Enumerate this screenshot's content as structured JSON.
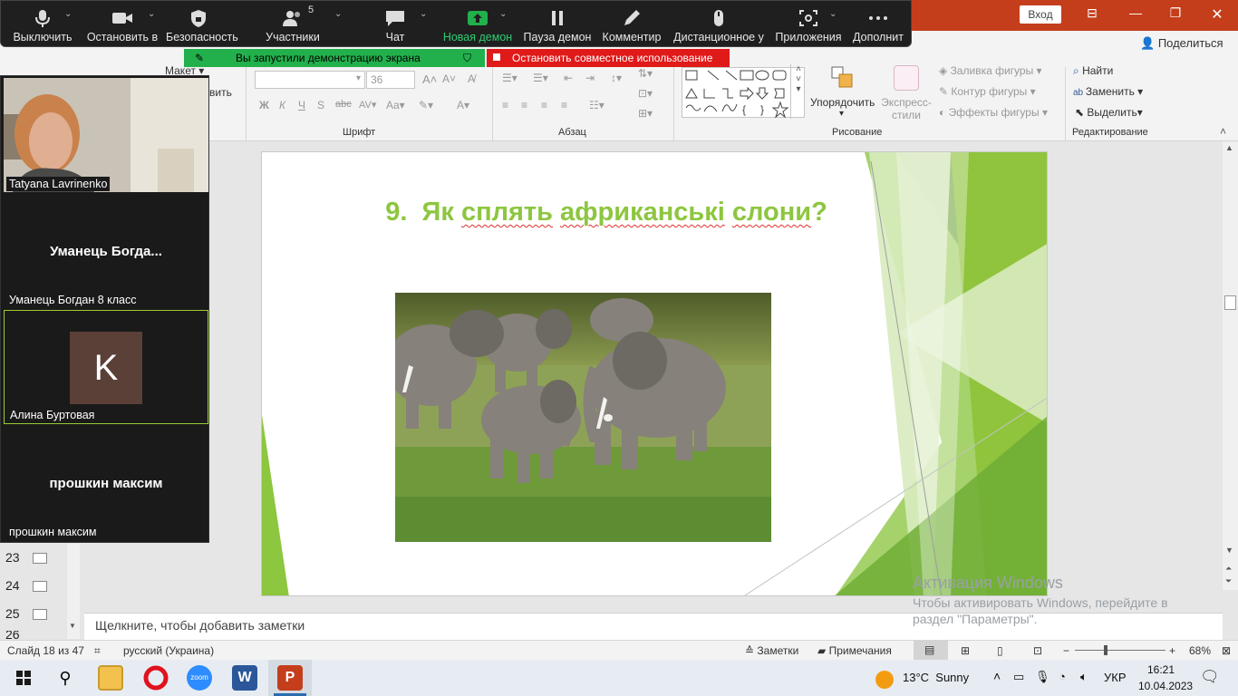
{
  "zoom_toolbar": {
    "mute": "Выключить",
    "stop_video": "Остановить в",
    "security": "Безопасность",
    "participants": "Участники",
    "participants_count": "5",
    "chat": "Чат",
    "new_share": "Новая демон",
    "pause_share": "Пауза демон",
    "annotate": "Комментир",
    "remote_control": "Дистанционное у",
    "apps": "Приложения",
    "more": "Дополнит"
  },
  "share_banner": {
    "text": "Вы запустили демонстрацию экрана",
    "stop": "Остановить совместное использование"
  },
  "gallery": {
    "tiles": [
      {
        "name": "Tatyana Lavrinenko"
      },
      {
        "center": "Уманець Богда...",
        "name": "Уманець Богдан 8 класс"
      },
      {
        "avatar": "K",
        "name": "Алина Буртовая"
      },
      {
        "center": "прошкин максим",
        "name": "прошкин максим"
      }
    ]
  },
  "ppt": {
    "login": "Вход",
    "share": "Поделиться",
    "layout": "Макет",
    "restore_partial": "вить",
    "font_size": "36",
    "groups": {
      "font": "Шрифт",
      "paragraph": "Абзац",
      "drawing": "Рисование",
      "editing": "Редактирование"
    },
    "drawing": {
      "arrange": "Упорядочить",
      "quick_styles": "Экспресс-стили",
      "fill": "Заливка фигуры",
      "outline": "Контур фигуры",
      "effects": "Эффекты фигуры"
    },
    "editing": {
      "find": "Найти",
      "replace": "Заменить",
      "select": "Выделить"
    }
  },
  "slide": {
    "number": "9.",
    "title_plain": "Як ",
    "title_words": [
      "сплять",
      "африканські",
      "слони"
    ],
    "title_end": "?"
  },
  "thumbnails": [
    "23",
    "24",
    "25",
    "26"
  ],
  "notes_placeholder": "Щелкните, чтобы добавить заметки",
  "statusbar": {
    "slide_info": "Слайд 18 из 47",
    "language": "русский (Украина)",
    "notes": "Заметки",
    "comments": "Примечания",
    "zoom": "68%"
  },
  "watermark": {
    "title": "Активация Windows",
    "line1": "Чтобы активировать Windows, перейдите в",
    "line2": "раздел \"Параметры\"."
  },
  "taskbar": {
    "weather_temp": "13°C",
    "weather_desc": "Sunny",
    "lang": "УКР",
    "time": "16:21",
    "date": "10.04.2023"
  }
}
